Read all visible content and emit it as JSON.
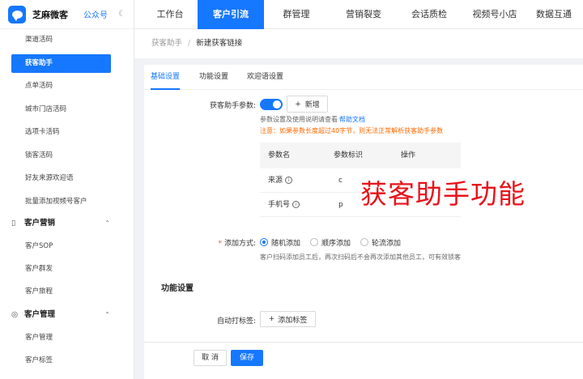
{
  "brand": {
    "name": "芝麻微客",
    "badge": "公众号",
    "theme_icon": "moon-icon"
  },
  "sidebar": {
    "items": [
      {
        "label": "渠道活码"
      },
      {
        "label": "获客助手",
        "active": true
      },
      {
        "label": "点单活码"
      },
      {
        "label": "城市门店活码"
      },
      {
        "label": "选项卡活码"
      },
      {
        "label": "锁客活码"
      },
      {
        "label": "好友来源欢迎语"
      },
      {
        "label": "批量添加视频号客户"
      }
    ],
    "groups": [
      {
        "label": "客户营销",
        "icon": "calendar-icon",
        "items": [
          {
            "label": "客户SOP"
          },
          {
            "label": "客户群发"
          },
          {
            "label": "客户旅程"
          }
        ]
      },
      {
        "label": "客户管理",
        "icon": "users-icon",
        "items": [
          {
            "label": "客户管理"
          },
          {
            "label": "客户标签"
          }
        ]
      }
    ]
  },
  "topnav": {
    "items": [
      {
        "label": "工作台"
      },
      {
        "label": "客户引流",
        "active": true
      },
      {
        "label": "群管理"
      },
      {
        "label": "营销裂变"
      },
      {
        "label": "会话质检"
      },
      {
        "label": "视频号小店"
      },
      {
        "label": "数据互通"
      }
    ]
  },
  "breadcrumb": {
    "parent": "获客助手",
    "separator": "/",
    "current": "新建获客链接"
  },
  "tabs": [
    {
      "label": "基础设置",
      "active": true
    },
    {
      "label": "功能设置"
    },
    {
      "label": "欢迎语设置"
    }
  ],
  "form": {
    "params_label": "获客助手参数:",
    "toggle_on": true,
    "new_button": "新增",
    "hint_prefix": "参数设置及使用说明请查看",
    "hint_link": "帮助文档",
    "warning": "注意：如果参数长度超过40字节，则无法正常解析获客助手参数",
    "table": {
      "headers": [
        "参数名",
        "参数标识",
        "操作"
      ],
      "rows": [
        {
          "name": "来源",
          "key": "c"
        },
        {
          "name": "手机号",
          "key": "p"
        }
      ]
    },
    "add_mode_label": "添加方式:",
    "add_mode_options": [
      {
        "label": "随机添加",
        "checked": true
      },
      {
        "label": "顺序添加"
      },
      {
        "label": "轮流添加"
      }
    ],
    "add_mode_hint": "客户扫码添加员工后，再次扫码后不会再次添加其他员工，可有效锁客",
    "section_title": "功能设置",
    "auto_tag_label": "自动打标签:",
    "add_tag_button": "添加标签"
  },
  "overlay_text": "获客助手功能",
  "footer": {
    "cancel": "取 消",
    "save": "保存"
  },
  "colors": {
    "primary": "#1677ff",
    "warning": "#ff6a00",
    "overlay": "#e8131b"
  }
}
